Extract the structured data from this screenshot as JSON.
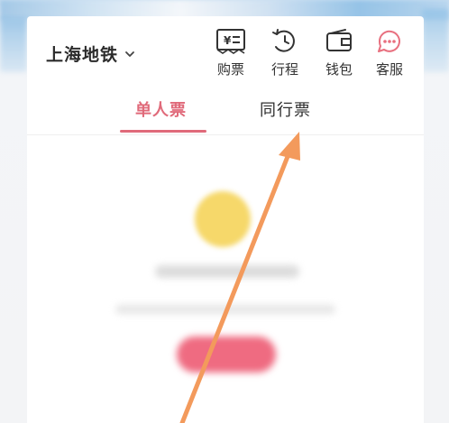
{
  "header": {
    "city": "上海地铁",
    "menu": [
      {
        "id": "buy",
        "label": "购票",
        "icon": "ticket-yen-icon"
      },
      {
        "id": "trip",
        "label": "行程",
        "icon": "history-clock-icon"
      },
      {
        "id": "wallet",
        "label": "钱包",
        "icon": "wallet-icon"
      },
      {
        "id": "service",
        "label": "客服",
        "icon": "chat-service-icon"
      }
    ]
  },
  "tabs": {
    "items": [
      {
        "label": "单人票",
        "active": true
      },
      {
        "label": "同行票",
        "active": false
      }
    ]
  },
  "colors": {
    "accent": "#e06a7a",
    "annotation_arrow": "#f39a5c",
    "service_icon": "#e8707f"
  }
}
